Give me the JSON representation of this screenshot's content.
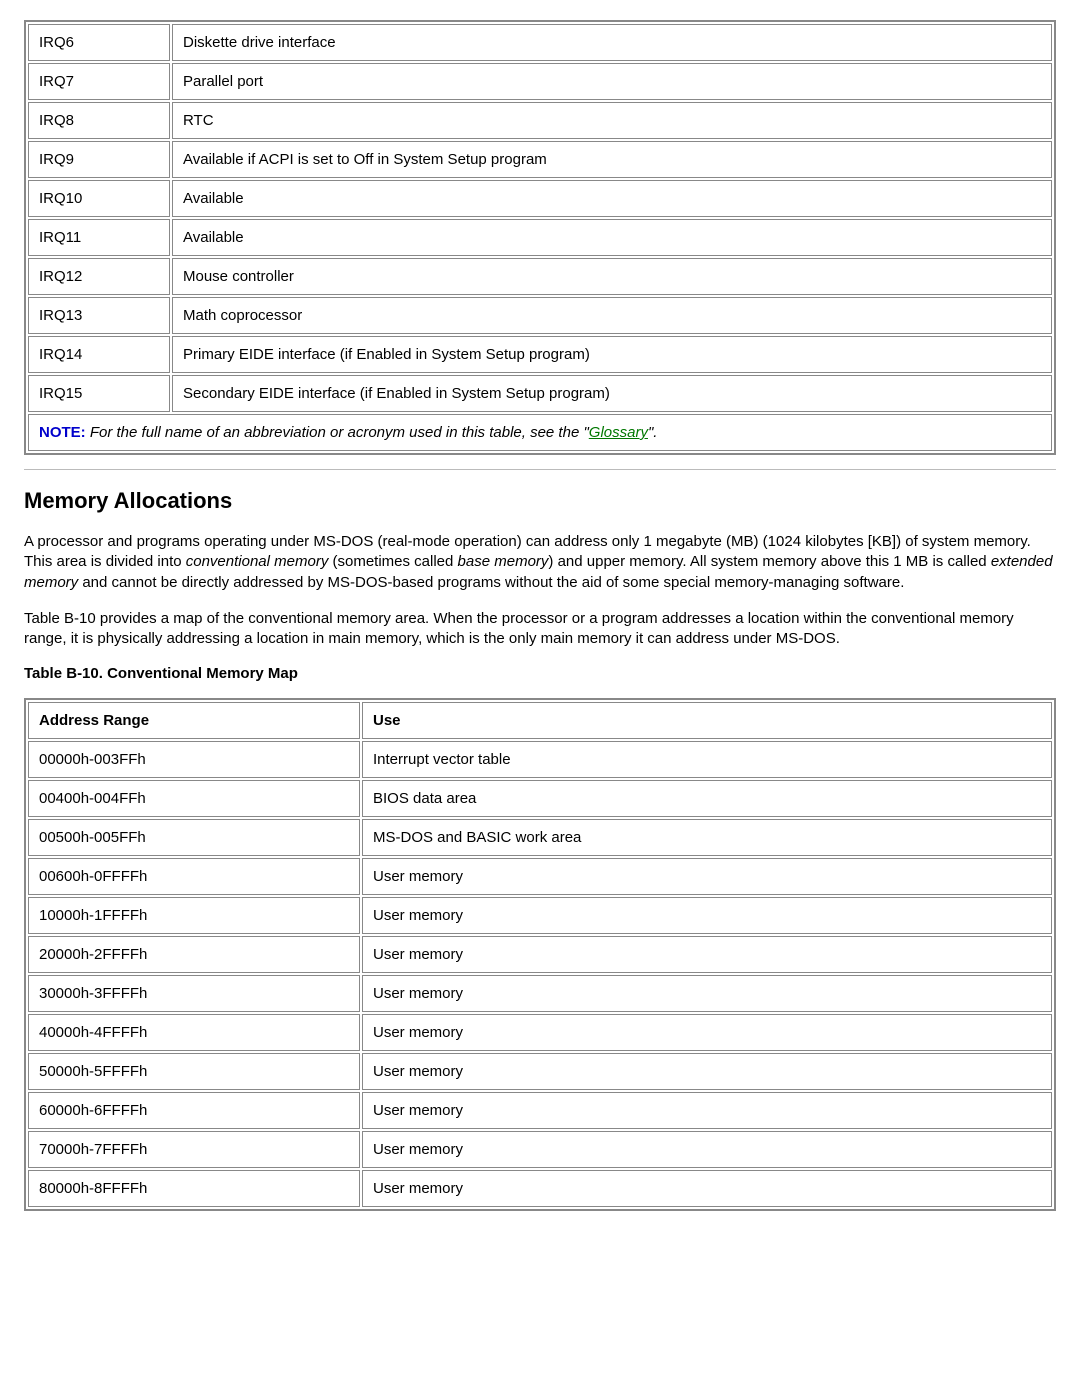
{
  "irq_table": {
    "rows": [
      {
        "irq": "IRQ6",
        "desc": "Diskette drive interface"
      },
      {
        "irq": "IRQ7",
        "desc": "Parallel port"
      },
      {
        "irq": "IRQ8",
        "desc": "RTC"
      },
      {
        "irq": "IRQ9",
        "desc": "Available if ACPI is set to Off in System Setup program"
      },
      {
        "irq": "IRQ10",
        "desc": "Available"
      },
      {
        "irq": "IRQ11",
        "desc": "Available"
      },
      {
        "irq": "IRQ12",
        "desc": "Mouse controller"
      },
      {
        "irq": "IRQ13",
        "desc": "Math coprocessor"
      },
      {
        "irq": "IRQ14",
        "desc": "Primary EIDE interface (if Enabled in System Setup program)"
      },
      {
        "irq": "IRQ15",
        "desc": "Secondary EIDE interface (if Enabled in System Setup program)"
      }
    ],
    "note_label": "NOTE:",
    "note_before": " For the full name of an abbreviation or acronym used in this table, see the \"",
    "note_link": "Glossary",
    "note_after": "\"."
  },
  "section": {
    "heading": "Memory Allocations",
    "p1_a": "A processor and programs operating under MS-DOS (real-mode operation) can address only 1 megabyte (MB) (1024 kilobytes [KB]) of system memory. This area is divided into ",
    "p1_i1": "conventional memory",
    "p1_b": " (sometimes called ",
    "p1_i2": "base memory",
    "p1_c": ") and upper memory. All system memory above this 1 MB is called ",
    "p1_i3": "extended memory",
    "p1_d": " and cannot be directly addressed by MS-DOS-based programs without the aid of some special memory-managing software.",
    "p2": "Table B-10 provides a map of the conventional memory area. When the processor or a program addresses a location within the conventional memory range, it is physically addressing a location in main memory, which is the only main memory it can address under MS-DOS."
  },
  "mem_table": {
    "caption": "Table B-10. Conventional Memory Map",
    "h1": "Address Range",
    "h2": "Use",
    "rows": [
      {
        "addr": "00000h-003FFh",
        "use": "Interrupt vector table"
      },
      {
        "addr": "00400h-004FFh",
        "use": "BIOS data area"
      },
      {
        "addr": "00500h-005FFh",
        "use": "MS-DOS and BASIC work area"
      },
      {
        "addr": "00600h-0FFFFh",
        "use": "User memory"
      },
      {
        "addr": "10000h-1FFFFh",
        "use": "User memory"
      },
      {
        "addr": "20000h-2FFFFh",
        "use": "User memory"
      },
      {
        "addr": "30000h-3FFFFh",
        "use": "User memory"
      },
      {
        "addr": "40000h-4FFFFh",
        "use": "User memory"
      },
      {
        "addr": "50000h-5FFFFh",
        "use": "User memory"
      },
      {
        "addr": "60000h-6FFFFh",
        "use": "User memory"
      },
      {
        "addr": "70000h-7FFFFh",
        "use": "User memory"
      },
      {
        "addr": "80000h-8FFFFh",
        "use": "User memory"
      }
    ]
  }
}
